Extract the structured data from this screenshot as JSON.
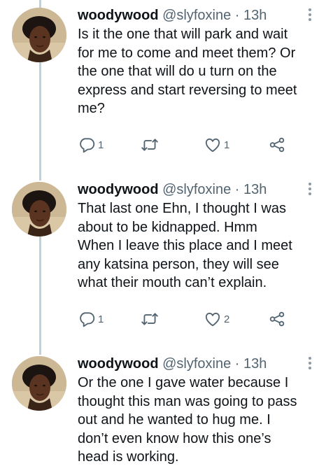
{
  "tweets": [
    {
      "name": "woodywood",
      "handle": "@slyfoxine",
      "separator": "·",
      "time": "13h",
      "lines": [
        "Is it the one that will park and wait",
        "for me to come and meet them? Or",
        "the one that will do u turn on the",
        "express and start reversing to meet",
        "me?"
      ],
      "reply_count": "1",
      "retweet_count": "",
      "like_count": "1"
    },
    {
      "name": "woodywood",
      "handle": "@slyfoxine",
      "separator": "·",
      "time": "13h",
      "lines": [
        "That last one Ehn, I thought I was",
        "about to be kidnapped. Hmm",
        "When I leave this place and I meet",
        "any katsina person, they will see",
        "what their mouth can’t explain."
      ],
      "reply_count": "1",
      "retweet_count": "",
      "like_count": "2"
    },
    {
      "name": "woodywood",
      "handle": "@slyfoxine",
      "separator": "·",
      "time": "13h",
      "lines": [
        "Or the one I gave water because I",
        "thought this man was going to pass",
        "out and he wanted to hug me. I",
        "don’t even know how this one’s",
        "head is working."
      ]
    }
  ],
  "icons": {
    "reply": "reply-icon",
    "retweet": "retweet-icon",
    "like": "like-icon",
    "share": "share-icon",
    "more": "more-vertical-icon"
  },
  "colors": {
    "text": "#0f1419",
    "secondary": "#536471",
    "thread_line": "#c4cfd6"
  }
}
